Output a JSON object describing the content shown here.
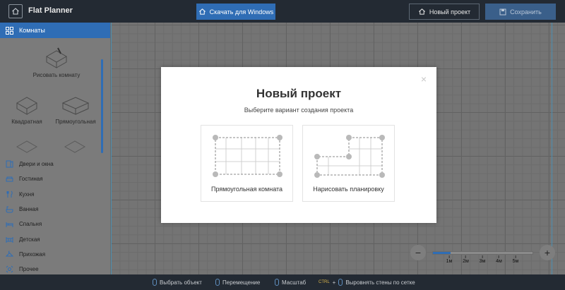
{
  "topbar": {
    "app_title": "Flat Planner",
    "download_label": "Скачать для Windows",
    "new_project_label": "Новый проект",
    "save_label": "Сохранить"
  },
  "sidebar": {
    "header_label": "Комнаты",
    "rooms": [
      {
        "label": "Рисовать комнату",
        "icon": "draw-room-icon"
      },
      {
        "label": "Квадратная",
        "icon": "square-room-icon"
      },
      {
        "label": "Прямоугольная",
        "icon": "rect-room-icon"
      },
      {
        "label": "",
        "icon": "room-icon"
      },
      {
        "label": "",
        "icon": "room-icon"
      }
    ],
    "categories": [
      {
        "label": "Двери и окна",
        "icon": "door-window-icon"
      },
      {
        "label": "Гостиная",
        "icon": "sofa-icon"
      },
      {
        "label": "Кухня",
        "icon": "kitchen-icon"
      },
      {
        "label": "Ванная",
        "icon": "bath-icon"
      },
      {
        "label": "Спальня",
        "icon": "bed-icon"
      },
      {
        "label": "Детская",
        "icon": "crib-icon"
      },
      {
        "label": "Прихожая",
        "icon": "hanger-icon"
      },
      {
        "label": "Прочее",
        "icon": "other-icon"
      }
    ]
  },
  "zoom": {
    "minus": "−",
    "plus": "+",
    "level_fraction": 0.18,
    "ticks": [
      "1м",
      "2м",
      "3м",
      "4м",
      "5м"
    ]
  },
  "bottombar": {
    "hint_select": "Выбрать объект",
    "hint_move": "Перемещение",
    "hint_zoom": "Масштаб",
    "ctrl_key": "CTRL",
    "plus_sign": "+",
    "hint_align": "Выровнять стены по сетке"
  },
  "modal": {
    "close": "×",
    "title": "Новый проект",
    "subtitle": "Выберите вариант создания проекта",
    "options": [
      {
        "label": "Прямоугольная комната"
      },
      {
        "label": "Нарисовать планировку"
      }
    ]
  },
  "colors": {
    "accent": "#2f6db5",
    "topbar": "#232a33",
    "overlay": "#6f6f6f"
  }
}
